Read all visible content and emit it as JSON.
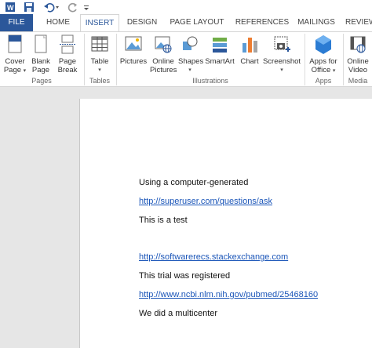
{
  "ribbon": {
    "tabs": [
      {
        "label": "FILE"
      },
      {
        "label": "HOME"
      },
      {
        "label": "INSERT"
      },
      {
        "label": "DESIGN"
      },
      {
        "label": "PAGE LAYOUT"
      },
      {
        "label": "REFERENCES"
      },
      {
        "label": "MAILINGS"
      },
      {
        "label": "REVIEW"
      }
    ],
    "active_tab": "INSERT",
    "groups": {
      "pages": {
        "label": "Pages",
        "buttons": [
          {
            "line1": "Cover",
            "line2": "Page",
            "icon": "cover-page-icon",
            "dropdown": true
          },
          {
            "line1": "Blank",
            "line2": "Page",
            "icon": "blank-page-icon"
          },
          {
            "line1": "Page",
            "line2": "Break",
            "icon": "page-break-icon"
          }
        ]
      },
      "tables": {
        "label": "Tables",
        "buttons": [
          {
            "line1": "Table",
            "icon": "table-icon",
            "dropdown": true
          }
        ]
      },
      "illustrations": {
        "label": "Illustrations",
        "buttons": [
          {
            "line1": "Pictures",
            "icon": "pictures-icon"
          },
          {
            "line1": "Online",
            "line2": "Pictures",
            "icon": "online-pictures-icon"
          },
          {
            "line1": "Shapes",
            "icon": "shapes-icon",
            "dropdown": true
          },
          {
            "line1": "SmartArt",
            "icon": "smartart-icon"
          },
          {
            "line1": "Chart",
            "icon": "chart-icon"
          },
          {
            "line1": "Screenshot",
            "icon": "screenshot-icon",
            "dropdown": true
          }
        ]
      },
      "apps": {
        "label": "Apps",
        "buttons": [
          {
            "line1": "Apps for",
            "line2": "Office",
            "icon": "apps-for-office-icon",
            "dropdown": true
          }
        ]
      },
      "media": {
        "label": "Media",
        "buttons": [
          {
            "line1": "Online",
            "line2": "Video",
            "icon": "online-video-icon"
          }
        ]
      }
    }
  },
  "colors": {
    "accent": "#2b579a",
    "link": "#1a55b8"
  },
  "document": {
    "lines": [
      {
        "text": "Using a computer-generated",
        "type": "text"
      },
      {
        "text": "http://superuser.com/questions/ask",
        "type": "link"
      },
      {
        "text": "This is a test",
        "type": "text"
      },
      {
        "text": "http://softwarerecs.stackexchange.com",
        "type": "link"
      },
      {
        "text": "This trial was registered",
        "type": "text"
      },
      {
        "text": "http://www.ncbi.nlm.nih.gov/pubmed/25468160",
        "type": "link"
      },
      {
        "text": "We did a multicenter",
        "type": "text"
      }
    ]
  }
}
